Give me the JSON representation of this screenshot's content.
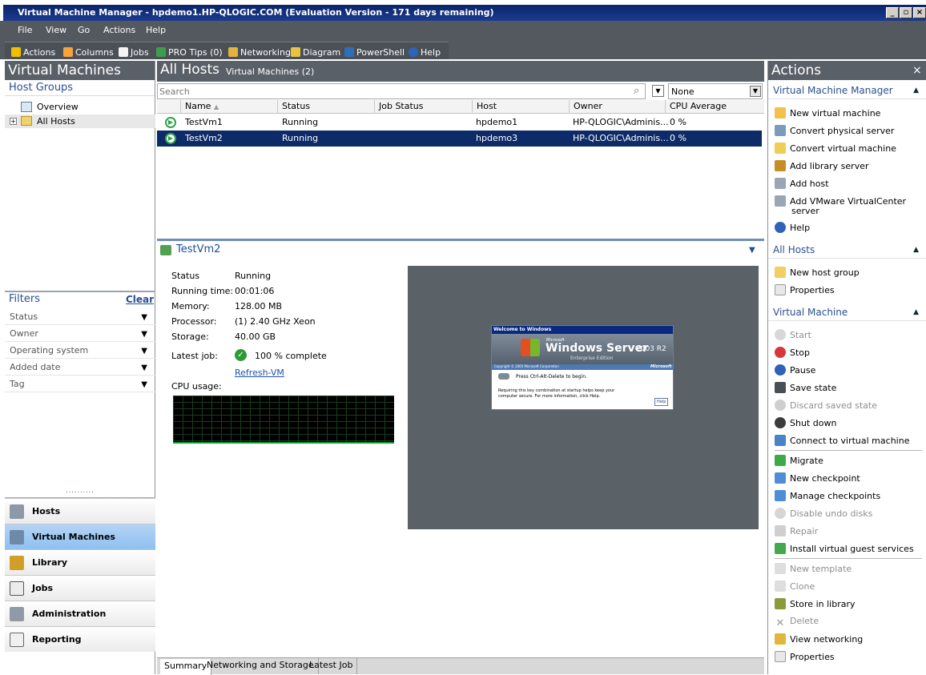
{
  "window": {
    "title": "Virtual Machine Manager - hpdemo1.HP-QLOGIC.COM (Evaluation Version - 171 days remaining)"
  },
  "menu": [
    "File",
    "View",
    "Go",
    "Actions",
    "Help"
  ],
  "toolbar": {
    "actions": "Actions",
    "columns": "Columns",
    "jobs": "Jobs",
    "pro_tips": "PRO Tips (0)",
    "networking": "Networking",
    "diagram": "Diagram",
    "powershell": "PowerShell",
    "help": "Help"
  },
  "left_pane": {
    "title": "Virtual Machines",
    "host_groups_label": "Host Groups",
    "tree": {
      "overview": "Overview",
      "expander": "+",
      "all_hosts": "All Hosts"
    },
    "filters_label": "Filters",
    "clear_label": "Clear",
    "filters": [
      "Status",
      "Owner",
      "Operating system",
      "Added date",
      "Tag"
    ],
    "splitter": "..........",
    "nav": [
      "Hosts",
      "Virtual Machines",
      "Library",
      "Jobs",
      "Administration",
      "Reporting"
    ]
  },
  "center": {
    "title": "All Hosts",
    "subtitle": "Virtual Machines (2)",
    "search_placeholder": "Search",
    "group_by": "None",
    "columns": [
      "Name",
      "Status",
      "Job Status",
      "Host",
      "Owner",
      "CPU Average"
    ],
    "rows": [
      {
        "name": "TestVm1",
        "status": "Running",
        "job_status": "",
        "host": "hpdemo1",
        "owner": "HP-QLOGIC\\Adminis...",
        "cpu": "0 %"
      },
      {
        "name": "TestVm2",
        "status": "Running",
        "job_status": "",
        "host": "hpdemo3",
        "owner": "HP-QLOGIC\\Adminis...",
        "cpu": "0 %"
      }
    ],
    "details": {
      "vm_name": "TestVm2",
      "status_label": "Status",
      "status": "Running",
      "running_time_label": "Running time:",
      "running_time": "00:01:06",
      "memory_label": "Memory:",
      "memory": "128.00 MB",
      "processor_label": "Processor:",
      "processor": "(1) 2.40 GHz Xeon",
      "storage_label": "Storage:",
      "storage": "40.00 GB",
      "latest_job_label": "Latest job:",
      "latest_job": "100 % complete",
      "refresh_link": "Refresh-VM",
      "cpu_usage_label": "CPU usage:"
    },
    "thumbnail": {
      "dialog_title": "Welcome to Windows",
      "brand": "Windows Server",
      "version": "2003 R2",
      "edition": "Enterprise Edition",
      "microsoft_small": "Microsoft",
      "copyright": "Copyright © 2005 Microsoft Corporation",
      "microsoft": "Microsoft",
      "prompt": "Press Ctrl-Alt-Delete to begin.",
      "info": "Requiring this key combination at startup helps keep your computer secure. For more information, click Help.",
      "help": "Help"
    },
    "tabs": [
      "Summary",
      "Networking and Storage",
      "Latest Job"
    ]
  },
  "actions_pane": {
    "title": "Actions",
    "close": "×",
    "sections": {
      "vmm": "Virtual Machine Manager",
      "all_hosts": "All Hosts",
      "vm": "Virtual Machine"
    },
    "vmm_actions": [
      "New virtual machine",
      "Convert physical server",
      "Convert virtual machine",
      "Add library server",
      "Add host",
      "Add VMware VirtualCenter",
      "server",
      "Help"
    ],
    "host_actions": [
      "New host group",
      "Properties"
    ],
    "vm_actions": [
      "Start",
      "Stop",
      "Pause",
      "Save state",
      "Discard saved state",
      "Shut down",
      "Connect to virtual machine",
      "Migrate",
      "New checkpoint",
      "Manage checkpoints",
      "Disable undo disks",
      "Repair",
      "Install virtual guest services",
      "New template",
      "Clone",
      "Store in library",
      "Delete",
      "View networking",
      "Properties"
    ]
  }
}
